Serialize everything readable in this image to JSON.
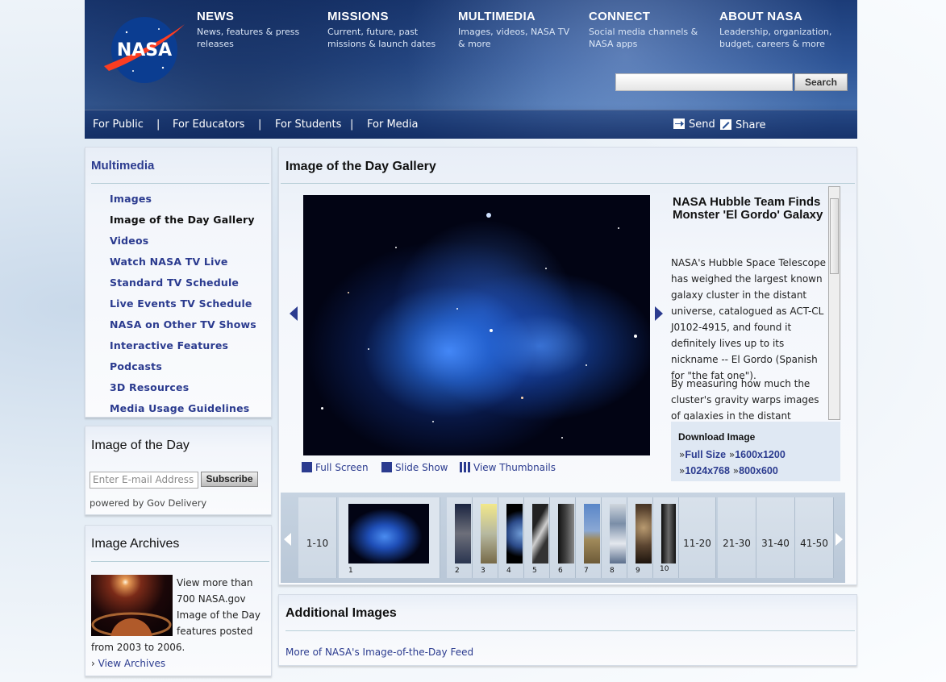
{
  "header": {
    "logo_text": "NASA",
    "nav": [
      {
        "title": "NEWS",
        "desc": "News, features & press releases"
      },
      {
        "title": "MISSIONS",
        "desc": "Current, future, past missions & launch dates"
      },
      {
        "title": "MULTIMEDIA",
        "desc": "Images, videos, NASA TV & more"
      },
      {
        "title": "CONNECT",
        "desc": "Social media channels & NASA apps"
      },
      {
        "title": "ABOUT NASA",
        "desc": "Leadership, organization, budget, careers & more"
      }
    ],
    "search": {
      "value": "",
      "button": "Search"
    },
    "audience": [
      "For Public",
      "For Educators",
      "For Students",
      "For Media"
    ],
    "separator": "|",
    "send": "Send",
    "share": "Share"
  },
  "sidebar": {
    "title": "Multimedia",
    "links": [
      "Images",
      "Image of the Day Gallery",
      "Videos",
      "Watch NASA TV Live",
      "Standard TV Schedule",
      "Live Events TV Schedule",
      "NASA on Other TV Shows",
      "Interactive Features",
      "Podcasts",
      "3D Resources",
      "Media Usage Guidelines"
    ],
    "iotd": {
      "title": "Image of the Day",
      "email_placeholder": "Enter E-mail Address",
      "subscribe": "Subscribe",
      "powered": "powered by Gov Delivery"
    },
    "archives": {
      "title": "Image Archives",
      "text": "View more than 700 NASA.gov Image of the Day features posted from 2003 to 2006.",
      "link_prefix": "›",
      "link": "View Archives"
    }
  },
  "main": {
    "title": "Image of the Day Gallery",
    "caption_title": "NASA Hubble Team Finds Monster 'El Gordo' Galaxy",
    "caption_p1": "NASA's Hubble Space Telescope has weighed the largest known galaxy cluster in the distant universe, catalogued as ACT-CL J0102-4915, and found it definitely lives up to its nickname -- El Gordo (Spanish for \"the fat one\").",
    "caption_p2": "By measuring how much the cluster's gravity warps images of galaxies in the distant background",
    "download": {
      "title": "Download Image",
      "bullet": "»",
      "full": "Full Size",
      "s1": "1600x1200",
      "s2": "1024x768",
      "s3": "800x600"
    },
    "controls": {
      "full_screen": "Full Screen",
      "slide_show": "Slide Show",
      "thumbs": "View Thumbnails"
    },
    "film": {
      "range_current": "1-10",
      "ranges": [
        "11-20",
        "21-30",
        "31-40",
        "41-50"
      ],
      "nums": [
        "1",
        "2",
        "3",
        "4",
        "5",
        "6",
        "7",
        "8",
        "9",
        "10"
      ]
    }
  },
  "additional": {
    "title": "Additional Images",
    "link": "More of NASA's Image-of-the-Day Feed"
  }
}
